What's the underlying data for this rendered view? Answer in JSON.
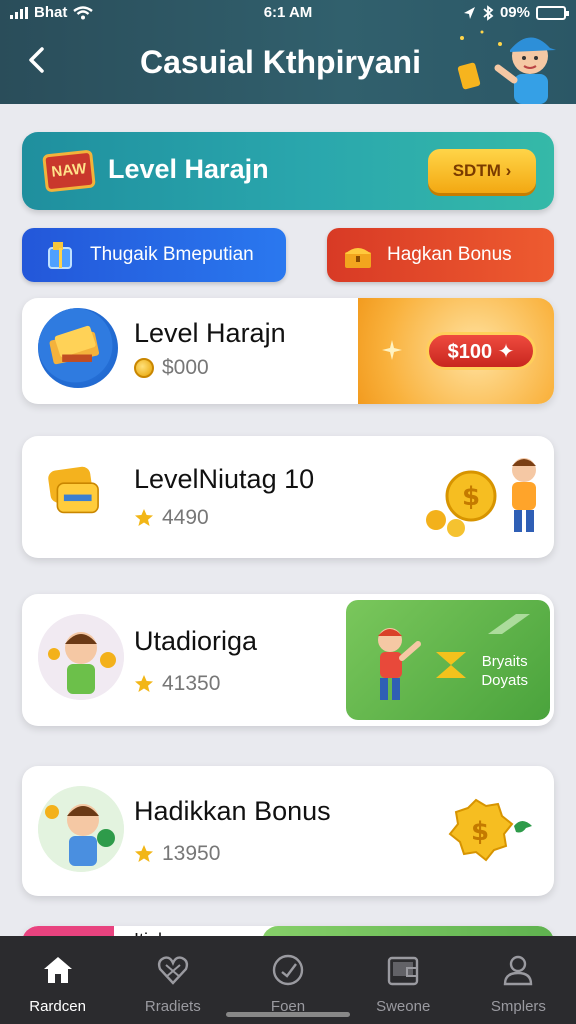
{
  "status_bar": {
    "carrier": "Bhat",
    "time": "6:1 AM",
    "battery": "09%"
  },
  "header": {
    "title": "Casuial Kthpiryani"
  },
  "banner": {
    "badge_text": "NAW",
    "title": "Level Harajn",
    "button_label": "SDTM ›"
  },
  "actions": [
    {
      "label": "Thugaik Bmeputian"
    },
    {
      "label": "Hagkan Bonus"
    }
  ],
  "cards": [
    {
      "title": "Level Harajn",
      "amount": "$000",
      "reward_label": "$100 ✦"
    },
    {
      "title": "LevelNiutag 10",
      "amount": "4490"
    },
    {
      "title": "Utadioriga",
      "amount": "41350",
      "reward_label_1": "Bryaits",
      "reward_label_2": "Doyats"
    },
    {
      "title": "Hadikkan Bonus",
      "amount": "13950"
    },
    {
      "title": "Itialr"
    }
  ],
  "nav": [
    {
      "label": "Rardcen",
      "icon": "home-icon",
      "active": true
    },
    {
      "label": "Rradiets",
      "icon": "heart-icon",
      "active": false
    },
    {
      "label": "Foen",
      "icon": "clock-icon",
      "active": false
    },
    {
      "label": "Sweone",
      "icon": "wallet-icon",
      "active": false
    },
    {
      "label": "Smplers",
      "icon": "profile-icon",
      "active": false
    }
  ],
  "colors": {
    "header": "#2b5766",
    "banner": "#2aa7ad",
    "accent_gold": "#f3a812",
    "blue_button": "#2357d9",
    "red_button": "#d83a25",
    "nav_bg": "#2b2b2e"
  }
}
